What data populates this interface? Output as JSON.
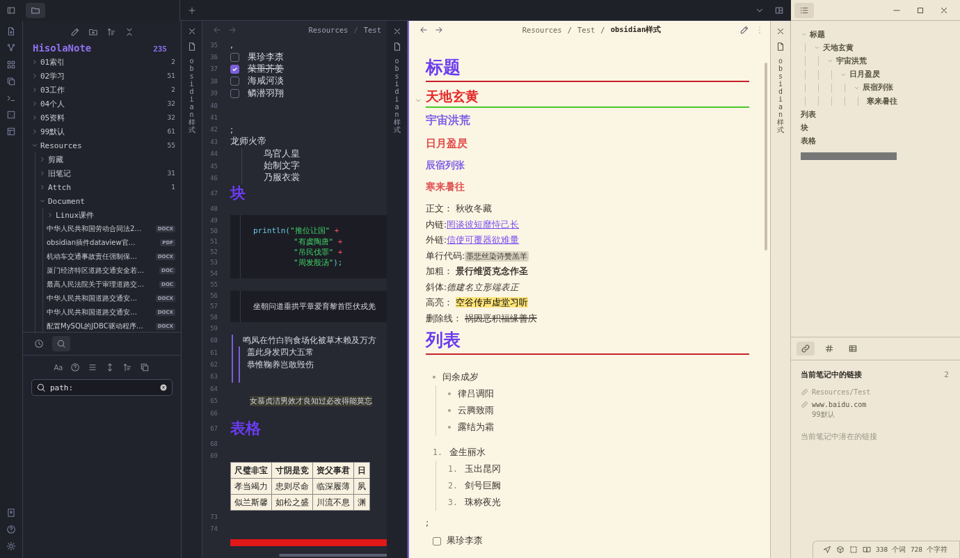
{
  "window": {
    "stack_tabs": [
      {
        "title": "obsidian样式"
      },
      {
        "title": "obsidian样式"
      },
      {
        "title": "obsidian样式"
      }
    ]
  },
  "file_explorer": {
    "vault": "HisolaNote",
    "count": "235",
    "items": [
      {
        "kind": "folder",
        "label": "01索引",
        "count": "2",
        "expanded": false
      },
      {
        "kind": "folder",
        "label": "02学习",
        "count": "51",
        "expanded": false
      },
      {
        "kind": "folder",
        "label": "03工作",
        "count": "2",
        "expanded": false
      },
      {
        "kind": "folder",
        "label": "04个人",
        "count": "32",
        "expanded": false
      },
      {
        "kind": "folder",
        "label": "05资料",
        "count": "32",
        "expanded": false
      },
      {
        "kind": "folder",
        "label": "99默认",
        "count": "61",
        "expanded": false
      },
      {
        "kind": "folder",
        "label": "Resources",
        "count": "55",
        "expanded": true,
        "children": [
          {
            "kind": "folder",
            "label": "剪藏",
            "expanded": false
          },
          {
            "kind": "folder",
            "label": "旧笔记",
            "count": "31",
            "expanded": false
          },
          {
            "kind": "folder",
            "label": "Attch",
            "count": "1",
            "expanded": false
          },
          {
            "kind": "folder",
            "label": "Document",
            "expanded": true,
            "children": [
              {
                "kind": "folder",
                "label": "Linux课件",
                "expanded": false
              },
              {
                "kind": "file",
                "label": "中华人民共和国劳动合同法2…",
                "ext": "DOCX"
              },
              {
                "kind": "file",
                "label": "obsidian插件dataview官…",
                "ext": "PDF"
              },
              {
                "kind": "file",
                "label": "机动车交通事故责任强制保…",
                "ext": "DOCX"
              },
              {
                "kind": "file",
                "label": "厦门经济特区道路交通安全若…",
                "ext": "DOC"
              },
              {
                "kind": "file",
                "label": "最高人民法院关于审理道路交…",
                "ext": "DOC"
              },
              {
                "kind": "file",
                "label": "中华人民共和国道路交通安…",
                "ext": "DOCX"
              },
              {
                "kind": "file",
                "label": "中华人民共和国道路交通安…",
                "ext": "DOCX"
              },
              {
                "kind": "file",
                "label": "配置MySQL的JDBC驱动程序…",
                "ext": "DOCX"
              }
            ]
          }
        ]
      }
    ]
  },
  "search_panel": {
    "tabs": [
      {
        "selected": false
      },
      {
        "selected": true
      }
    ],
    "match_case": "Aa",
    "query": "path:"
  },
  "source_pane": {
    "breadcrumb": {
      "separator": "/",
      "items": [
        "Resources",
        "Test"
      ]
    },
    "lines": [
      {
        "num": "35",
        "kind": "text",
        "text": ","
      },
      {
        "num": "36",
        "kind": "task",
        "text": "果珍李柰",
        "checked": false
      },
      {
        "num": "37",
        "kind": "task",
        "text": "菜重芥姜",
        "checked": true
      },
      {
        "num": "38",
        "kind": "task",
        "text": "海咸河淡",
        "checked": false
      },
      {
        "num": "39",
        "kind": "task",
        "text": "鳞潜羽翔",
        "checked": false
      },
      {
        "num": "40",
        "kind": "blank"
      },
      {
        "num": "41",
        "kind": "blank"
      },
      {
        "num": "42",
        "kind": "text",
        "text": ";"
      },
      {
        "num": "43",
        "kind": "text",
        "text": "龙师火帝"
      },
      {
        "num": "44",
        "kind": "indented",
        "text": "鸟官人皇"
      },
      {
        "num": "45",
        "kind": "indented",
        "text": "始制文字"
      },
      {
        "num": "46",
        "kind": "indented",
        "text": "乃服衣裳"
      },
      {
        "num": "47",
        "kind": "heading",
        "text": "块"
      },
      {
        "num": "48",
        "kind": "blank"
      },
      {
        "num": "49",
        "kind": "code"
      },
      {
        "num": "50",
        "kind": "code",
        "tokens": [
          {
            "kind": "fn",
            "text": "println("
          },
          {
            "kind": "string",
            "text": "\"推位让国\""
          },
          {
            "kind": "op",
            "text": " +"
          }
        ]
      },
      {
        "num": "51",
        "kind": "code-continued",
        "tokens": [
          {
            "kind": "string",
            "text": "\"有虞陶唐\""
          },
          {
            "kind": "op",
            "text": " +"
          }
        ]
      },
      {
        "num": "52",
        "kind": "code-continued",
        "tokens": [
          {
            "kind": "string",
            "text": "\"吊民伐罪\""
          },
          {
            "kind": "op",
            "text": " +"
          }
        ]
      },
      {
        "num": "53",
        "kind": "code-continued",
        "tokens": [
          {
            "kind": "string",
            "text": "\"周发殷汤\""
          },
          {
            "kind": "fn",
            "text": ");"
          }
        ]
      },
      {
        "num": "54",
        "kind": "code"
      },
      {
        "num": "55",
        "kind": "blank"
      },
      {
        "num": "56",
        "kind": "code"
      },
      {
        "num": "57",
        "kind": "code",
        "tokens": [
          {
            "kind": "plain",
            "text": "坐朝问道垂拱平章爱育黎首臣伏戎羌"
          }
        ]
      },
      {
        "num": "58",
        "kind": "code"
      },
      {
        "num": "59",
        "kind": "blank"
      },
      {
        "num": "60",
        "kind": "quote",
        "text": "鸣凤在竹白驹食场化被草木赖及万方"
      },
      {
        "num": "61",
        "kind": "quote-nested",
        "text": "盖此身发四大五常"
      },
      {
        "num": "62",
        "kind": "quote-nested",
        "text": "恭惟鞠养岂敢毁伤"
      },
      {
        "num": "63",
        "kind": "quote-nested"
      },
      {
        "num": "64",
        "kind": "blank"
      },
      {
        "num": "65",
        "kind": "highlight",
        "text": "女慕贞洁男效才良知过必改得能莫忘"
      },
      {
        "num": "66",
        "kind": "blank"
      },
      {
        "num": "67",
        "kind": "heading",
        "text": "表格"
      },
      {
        "num": "68",
        "kind": "blank"
      },
      {
        "num": "69",
        "kind": "blank"
      },
      {
        "kind": "table",
        "header": [
          "尺璧非宝",
          "寸阴是竞",
          "资父事君",
          "日"
        ],
        "rows": [
          [
            "孝当竭力",
            "忠则尽命",
            "临深履薄",
            "夙"
          ],
          [
            "似兰斯馨",
            "如松之盛",
            "川流不息",
            "渊"
          ]
        ]
      },
      {
        "num": "73",
        "kind": "blank"
      },
      {
        "num": "74",
        "kind": "blank"
      },
      {
        "kind": "bar"
      }
    ]
  },
  "reading_pane": {
    "breadcrumb": {
      "separator": "/",
      "items": [
        "Resources",
        "Test",
        "obsidian样式"
      ]
    },
    "blocks": [
      {
        "kind": "h1",
        "text": "标题"
      },
      {
        "kind": "h2",
        "text": "天地玄黄",
        "expanded": true
      },
      {
        "kind": "h3",
        "text": "宇宙洪荒"
      },
      {
        "kind": "h4",
        "text": "日月盈昃"
      },
      {
        "kind": "h5",
        "text": "辰宿列张"
      },
      {
        "kind": "h6",
        "text": "寒来暑往"
      },
      {
        "kind": "plain-field",
        "label": "正文： ",
        "value": "秋收冬藏"
      },
      {
        "kind": "internal-link-field",
        "label": "内链:",
        "value": "罔谈彼短靡恃己长"
      },
      {
        "kind": "external-link-field",
        "label": "外链:",
        "value": "信使可覆器欲难量"
      },
      {
        "kind": "code-field",
        "label": "单行代码:",
        "value": "墨悲丝染诗赞羔羊"
      },
      {
        "kind": "bold-field",
        "label": "加粗： ",
        "value": "景行维贤克念作圣"
      },
      {
        "kind": "italic-field",
        "label": "斜体:",
        "value": "德建名立形端表正"
      },
      {
        "kind": "highlight-field",
        "label": "高亮： ",
        "value": "空谷传声虚堂习听"
      },
      {
        "kind": "strikethrough-field",
        "label": "删除线： ",
        "value": "祸因恶积福缘善庆"
      },
      {
        "kind": "h1",
        "text": "列表"
      },
      {
        "kind": "bullet-list",
        "items": [
          {
            "text": "闰余成岁",
            "children": [
              {
                "text": "律吕调阳"
              },
              {
                "text": "云腾致雨"
              },
              {
                "text": "露结为霜"
              }
            ]
          }
        ]
      },
      {
        "kind": "ordered-list",
        "items": [
          {
            "marker": "1.",
            "text": "金生丽水",
            "children": [
              {
                "marker": "1.",
                "text": "玉出昆冈"
              },
              {
                "marker": "2.",
                "text": "剑号巨阙"
              },
              {
                "marker": "3.",
                "text": "珠称夜光"
              }
            ]
          }
        ]
      },
      {
        "kind": "paragraph",
        "text": ";"
      },
      {
        "kind": "task",
        "text": "果珍李柰",
        "checked": false
      }
    ]
  },
  "outline": {
    "items": [
      {
        "text": "标题",
        "expanded": true,
        "children": [
          {
            "text": "天地玄黄",
            "expanded": true,
            "children": [
              {
                "text": "宇宙洪荒",
                "expanded": true,
                "children": [
                  {
                    "text": "日月盈昃",
                    "expanded": true,
                    "children": [
                      {
                        "text": "辰宿列张",
                        "expanded": true,
                        "children": [
                          {
                            "text": "寒来暑往"
                          }
                        ]
                      }
                    ]
                  }
                ]
              }
            ]
          }
        ]
      },
      {
        "text": "列表"
      },
      {
        "text": "块"
      },
      {
        "text": "表格"
      }
    ]
  },
  "links_panel": {
    "tabs": [
      {
        "selected": true
      },
      {
        "selected": false
      },
      {
        "selected": false
      }
    ],
    "title": "当前笔记中的链接",
    "count": "2",
    "links": [
      {
        "text": "Resources/Test",
        "resolved": false
      },
      {
        "text": "www.baidu.com",
        "folder": "99默认",
        "resolved": true
      }
    ],
    "unlinked_title": "当前笔记中潜在的链接"
  },
  "status_bar": {
    "words": "338 个词",
    "chars": "728 个字符"
  }
}
